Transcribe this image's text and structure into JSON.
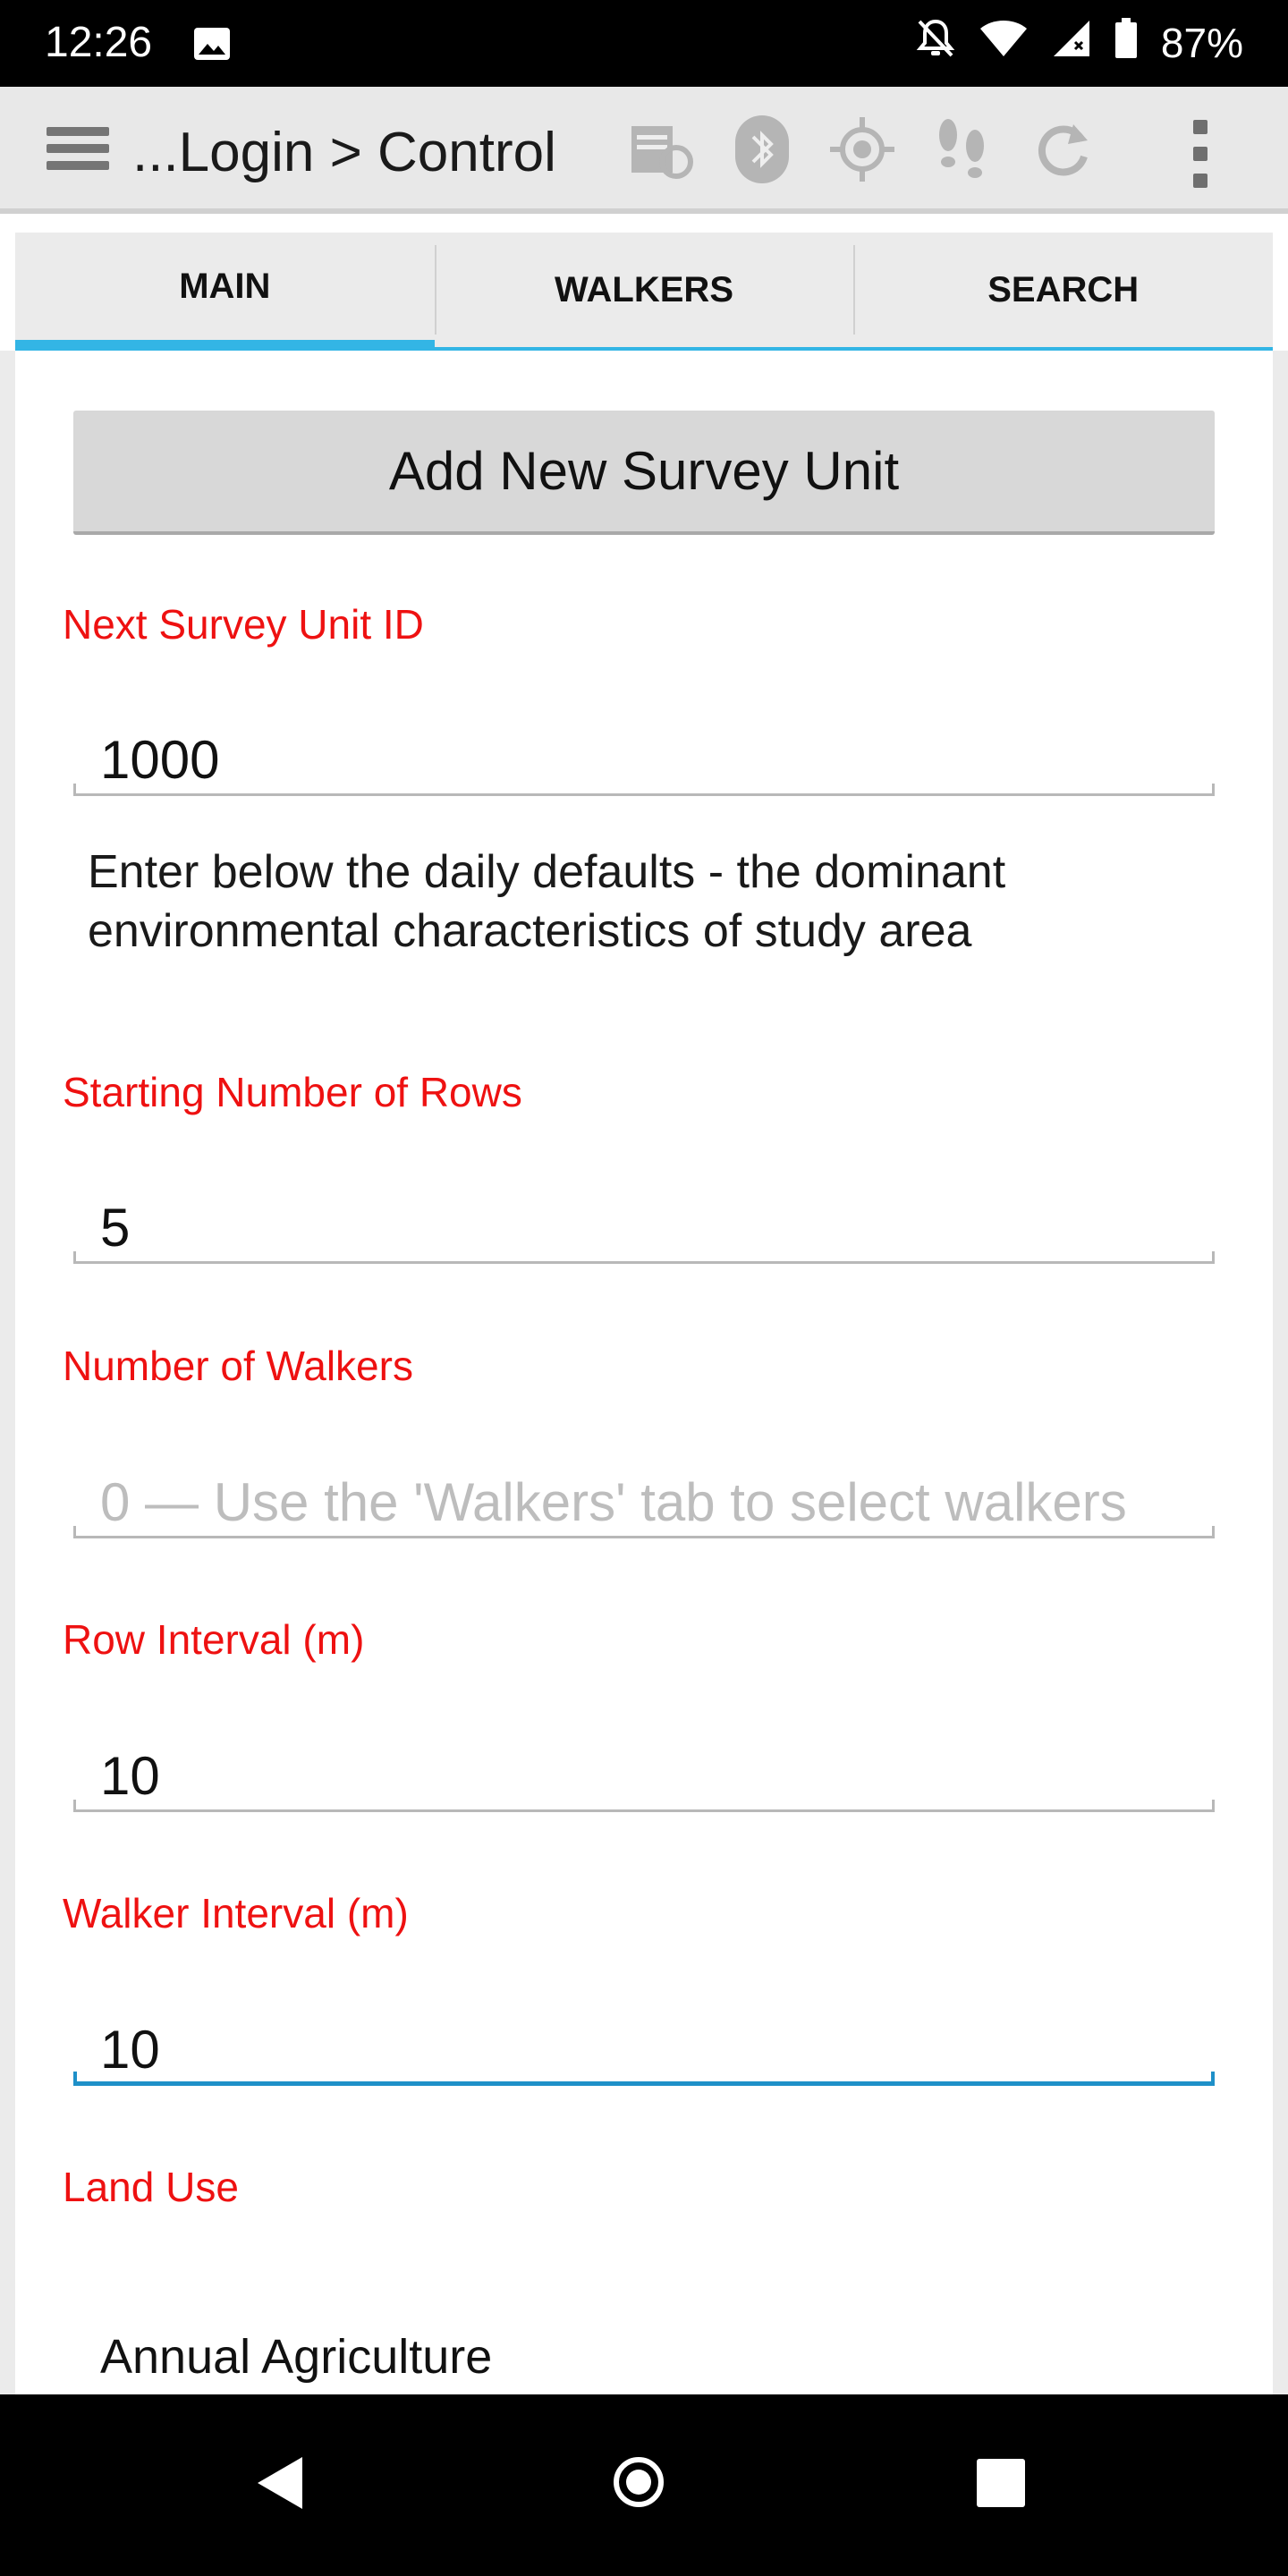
{
  "status_bar": {
    "time": "12:26",
    "battery_percent": "87%",
    "icons": [
      "image-icon",
      "notifications-off-icon",
      "wifi-icon",
      "cell-signal-icon",
      "battery-icon"
    ]
  },
  "action_bar": {
    "title": "...Login > Control",
    "icons": [
      "menu-icon",
      "form-sync-icon",
      "bluetooth-icon",
      "gps-icon",
      "footsteps-icon",
      "refresh-icon",
      "overflow-menu-icon"
    ]
  },
  "tabs": [
    {
      "label": "MAIN",
      "active": true
    },
    {
      "label": "WALKERS",
      "active": false
    },
    {
      "label": "SEARCH",
      "active": false
    }
  ],
  "main": {
    "add_button_label": "Add New Survey Unit",
    "next_id": {
      "label": "Next Survey Unit ID",
      "value": "1000"
    },
    "info_text": "Enter below the daily defaults - the dominant environmental characteristics of study area",
    "starting_rows": {
      "label": "Starting Number of Rows",
      "value": "5"
    },
    "walkers": {
      "label": "Number of Walkers",
      "placeholder": "0 — Use the 'Walkers' tab to select walkers"
    },
    "row_interval": {
      "label": "Row Interval (m)",
      "value": "10"
    },
    "walker_interval": {
      "label": "Walker Interval (m)",
      "value": "10"
    },
    "land_use": {
      "label": "Land Use",
      "value": "Annual Agriculture"
    }
  },
  "colors": {
    "accent": "#33b5e5",
    "label_red": "#ee1111",
    "focus_blue": "#1e90c8",
    "action_bar_bg": "#e8e8e8"
  }
}
